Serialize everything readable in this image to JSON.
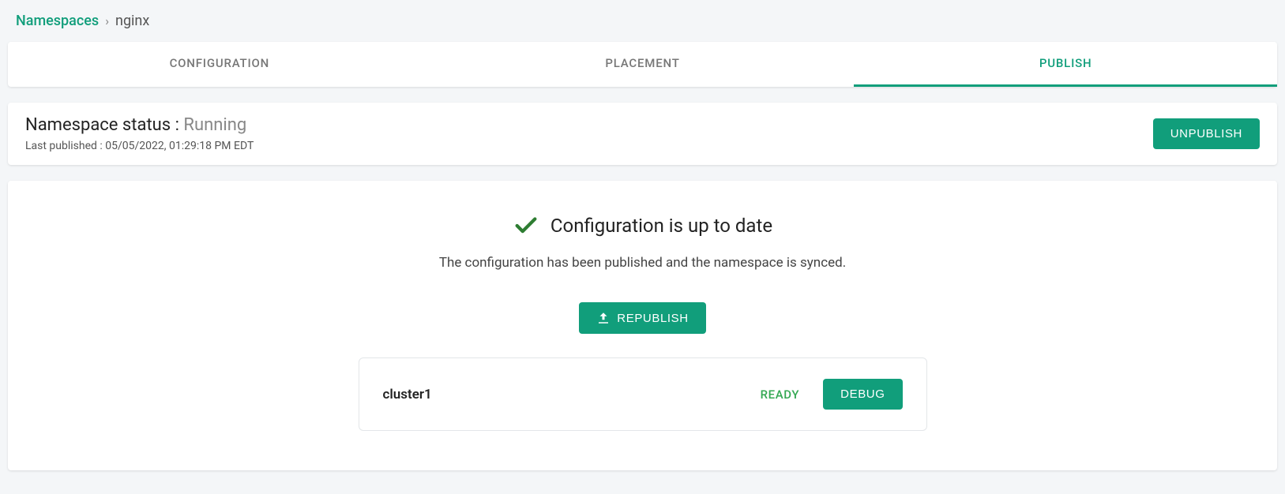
{
  "breadcrumb": {
    "root": "Namespaces",
    "current": "nginx"
  },
  "tabs": [
    "CONFIGURATION",
    "PLACEMENT",
    "PUBLISH"
  ],
  "activeTabIndex": 2,
  "status": {
    "label": "Namespace status :",
    "value": "Running",
    "lastPublished": "Last published : 05/05/2022, 01:29:18 PM EDT",
    "unpublishBtn": "UNPUBLISH"
  },
  "publish": {
    "headline": "Configuration is up to date",
    "subtext": "The configuration has been published and the namespace is synced.",
    "republishBtn": "REPUBLISH"
  },
  "clusters": [
    {
      "name": "cluster1",
      "status": "READY",
      "action": "DEBUG"
    }
  ]
}
